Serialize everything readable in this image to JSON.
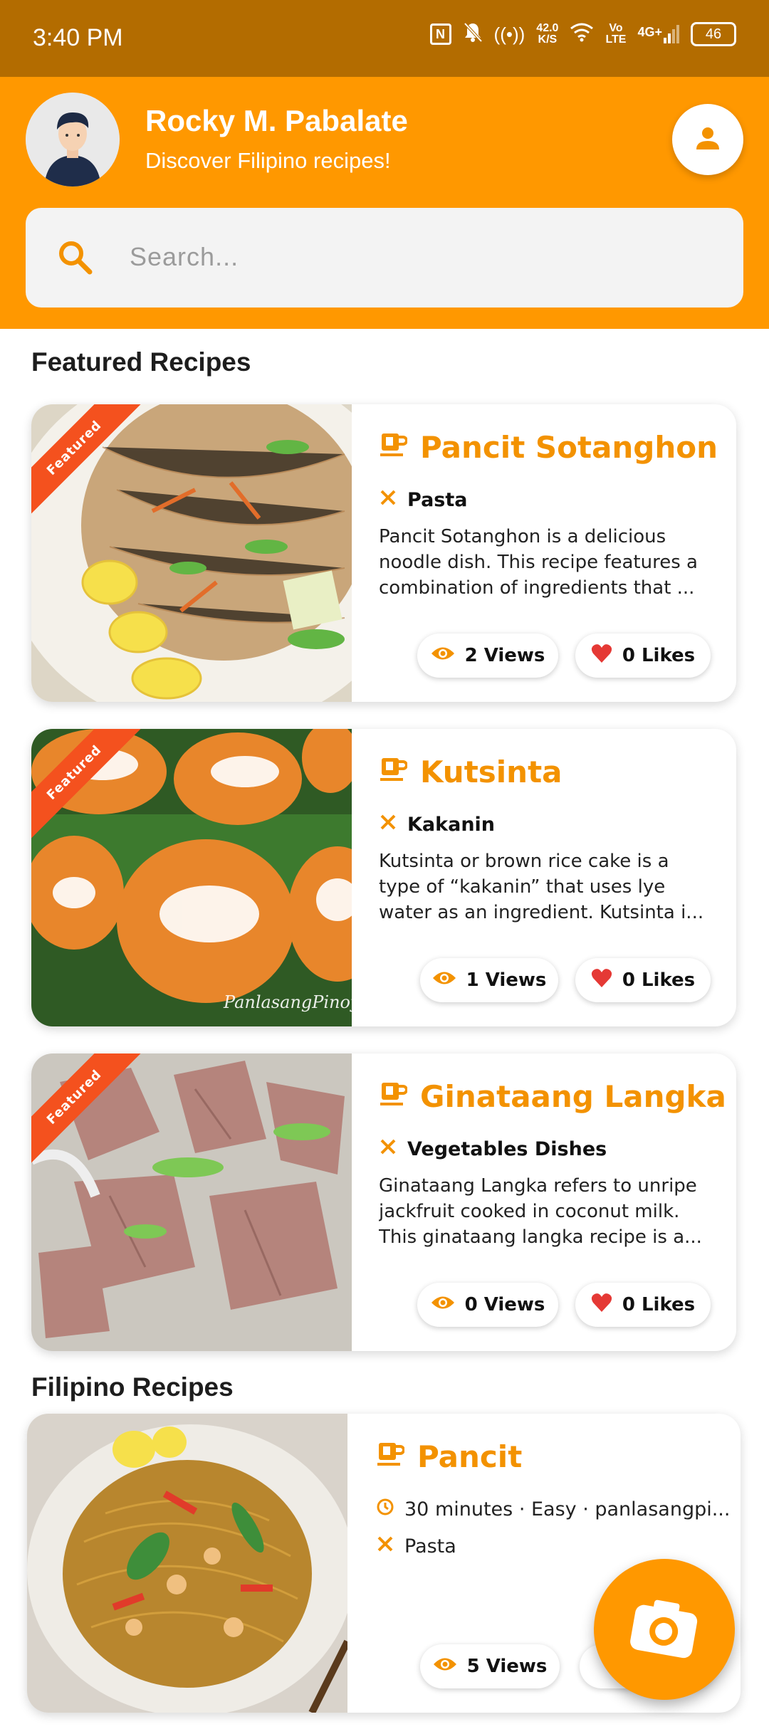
{
  "status_bar": {
    "time": "3:40 PM",
    "net_speed_value": "42.0",
    "net_speed_unit": "K/S",
    "volte_top": "Vo",
    "volte_bottom": "LTE",
    "network": "4G+",
    "battery": "46"
  },
  "header": {
    "user_name": "Rocky M. Pabalate",
    "subtitle": "Discover Filipino recipes!",
    "search_placeholder": "Search..."
  },
  "sections": {
    "featured_title": "Featured Recipes",
    "filipino_title": "Filipino Recipes"
  },
  "featured": [
    {
      "badge": "Featured",
      "title": "Pancit Sotanghon",
      "category": "Pasta",
      "description": "Pancit Sotanghon is a delicious noodle dish. This recipe features a combination of ingredients that ...",
      "views": "2 Views",
      "likes": "0 Likes"
    },
    {
      "badge": "Featured",
      "title": "Kutsinta",
      "category": "Kakanin",
      "description": "Kutsinta or brown rice cake is a type of “kakanin” that uses lye water as an ingredient. Kutsinta i...",
      "views": "1 Views",
      "likes": "0 Likes",
      "watermark": "PanlasangPinoy"
    },
    {
      "badge": "Featured",
      "title": "Ginataang Langka",
      "category": "Vegetables Dishes",
      "description": "Ginataang Langka refers to unripe jackfruit cooked in coconut milk. This ginataang langka recipe is a...",
      "views": "0 Views",
      "likes": "0 Likes"
    }
  ],
  "filipino": [
    {
      "title": "Pancit",
      "meta": "30 minutes · Easy · panlasangpi...",
      "category": "Pasta",
      "views": "5 Views"
    }
  ],
  "colors": {
    "status_bar": "#b36c00",
    "header": "#ff9800",
    "accent_text": "#f39200",
    "ribbon": "#f4511e",
    "heart": "#e53935"
  }
}
